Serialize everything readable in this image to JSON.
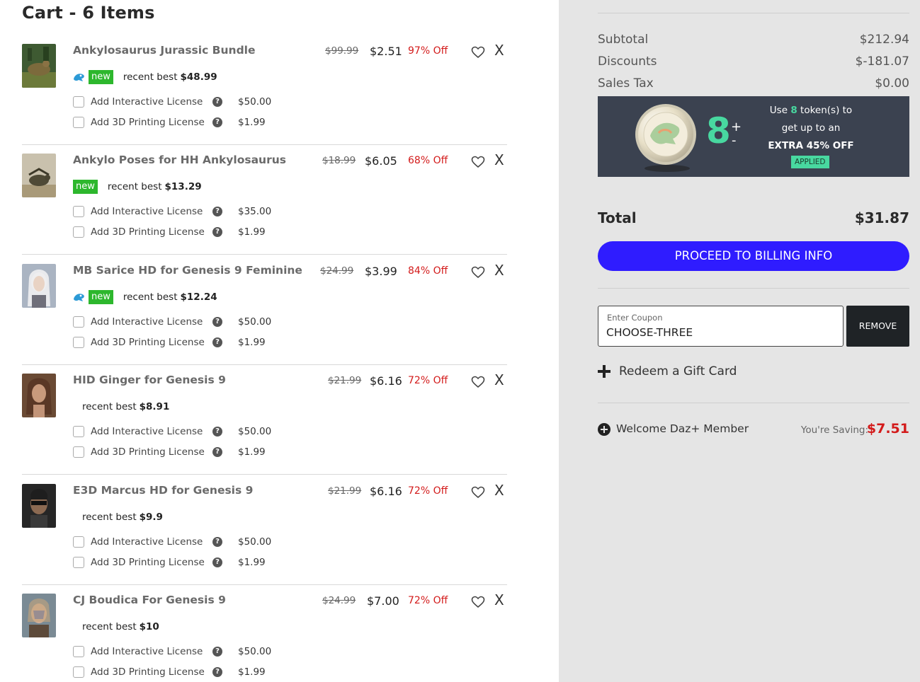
{
  "cart": {
    "title": "Cart - 6 Items",
    "items": [
      {
        "name": "Ankylosaurus Jurassic Bundle",
        "original_price": "$99.99",
        "price": "$2.51",
        "discount": "97% Off",
        "has_daz_icon": true,
        "has_new_badge": true,
        "new_label": "new",
        "recent_best_label": "recent best",
        "recent_best_value": "$48.99",
        "licenses": [
          {
            "label": "Add Interactive License",
            "price": "$50.00"
          },
          {
            "label": "Add 3D Printing License",
            "price": "$1.99"
          }
        ],
        "thumb_icon": "dinosaur-bundle-thumbnail"
      },
      {
        "name": "Ankylo Poses for HH Ankylosaurus",
        "original_price": "$18.99",
        "price": "$6.05",
        "discount": "68% Off",
        "has_daz_icon": false,
        "has_new_badge": true,
        "new_label": "new",
        "recent_best_label": "recent best",
        "recent_best_value": "$13.29",
        "licenses": [
          {
            "label": "Add Interactive License",
            "price": "$35.00"
          },
          {
            "label": "Add 3D Printing License",
            "price": "$1.99"
          }
        ],
        "thumb_icon": "ankylosaurus-thumbnail"
      },
      {
        "name": "MB Sarice HD for Genesis 9 Feminine",
        "original_price": "$24.99",
        "price": "$3.99",
        "discount": "84% Off",
        "has_daz_icon": true,
        "has_new_badge": true,
        "new_label": "new",
        "recent_best_label": "recent best",
        "recent_best_value": "$12.24",
        "licenses": [
          {
            "label": "Add Interactive License",
            "price": "$50.00"
          },
          {
            "label": "Add 3D Printing License",
            "price": "$1.99"
          }
        ],
        "thumb_icon": "character-portrait-thumbnail"
      },
      {
        "name": "HID Ginger for Genesis 9",
        "original_price": "$21.99",
        "price": "$6.16",
        "discount": "72% Off",
        "has_daz_icon": false,
        "has_new_badge": false,
        "new_label": "",
        "recent_best_label": "recent best",
        "recent_best_value": "$8.91",
        "licenses": [
          {
            "label": "Add Interactive License",
            "price": "$50.00"
          },
          {
            "label": "Add 3D Printing License",
            "price": "$1.99"
          }
        ],
        "thumb_icon": "character-portrait-thumbnail"
      },
      {
        "name": "E3D Marcus HD for Genesis 9",
        "original_price": "$21.99",
        "price": "$6.16",
        "discount": "72% Off",
        "has_daz_icon": false,
        "has_new_badge": false,
        "new_label": "",
        "recent_best_label": "recent best",
        "recent_best_value": "$9.9",
        "licenses": [
          {
            "label": "Add Interactive License",
            "price": "$50.00"
          },
          {
            "label": "Add 3D Printing License",
            "price": "$1.99"
          }
        ],
        "thumb_icon": "character-portrait-thumbnail"
      },
      {
        "name": "CJ Boudica For Genesis 9",
        "original_price": "$24.99",
        "price": "$7.00",
        "discount": "72% Off",
        "has_daz_icon": false,
        "has_new_badge": false,
        "new_label": "",
        "recent_best_label": "recent best",
        "recent_best_value": "$10",
        "licenses": [
          {
            "label": "Add Interactive License",
            "price": "$50.00"
          },
          {
            "label": "Add 3D Printing License",
            "price": "$1.99"
          }
        ],
        "thumb_icon": "character-portrait-thumbnail"
      }
    ]
  },
  "summary": {
    "subtotal_label": "Subtotal",
    "subtotal_value": "$212.94",
    "discounts_label": "Discounts",
    "discounts_value": "$-181.07",
    "tax_label": "Sales Tax",
    "tax_value": "$0.00",
    "tokens": {
      "count": "8",
      "plus": "+",
      "minus": "-",
      "text_use": "Use",
      "text_count": "8",
      "text_tokens": "token(s) to",
      "text_line2": "get up to an",
      "text_line3": "EXTRA 45% OFF",
      "applied": "APPLIED"
    },
    "total_label": "Total",
    "total_value": "$31.87",
    "proceed_label": "PROCEED TO BILLING INFO",
    "coupon_placeholder": "Enter Coupon",
    "coupon_value": "CHOOSE-THREE",
    "coupon_remove": "REMOVE",
    "gift_card_label": "Redeem a Gift Card",
    "member_label": "Welcome Daz+ Member",
    "saving_label": "You're Saving:",
    "saving_value": "$7.51"
  },
  "colors": {
    "accent_button": "#2f1cff",
    "discount_red": "#d31b1b",
    "new_badge": "#2db72d",
    "token_green": "#48d8a0",
    "summary_bg": "#e5e5e5"
  }
}
